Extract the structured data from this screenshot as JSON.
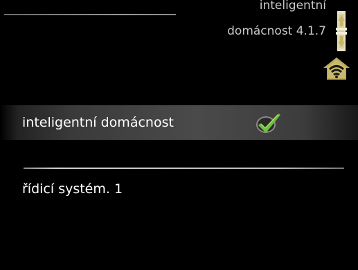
{
  "header": {
    "title_line1": "inteligentní",
    "title_line2": "domácnost 4.1.7"
  },
  "icons": {
    "scroll": "scrollbar-arrows-icon",
    "home_wifi": "smart-home-wifi-icon",
    "checkmark": "checkmark-icon"
  },
  "menu": {
    "item1_label": "inteligentní domácnost",
    "item1_checked": true,
    "item2_label": "řídicí systém. 1"
  },
  "colors": {
    "background": "#000000",
    "selected_row": "#4a4a4a",
    "check_green": "#6fbf3c",
    "icon_gold": "#c8b46a"
  }
}
